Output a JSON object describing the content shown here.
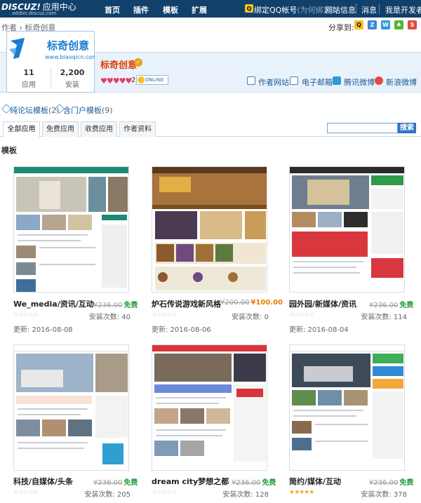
{
  "topbar": {
    "logo_main": "DISCUZ!",
    "logo_suffix": "应用中心",
    "logo_sub": "addon.discuz.com",
    "nav": [
      "首页",
      "插件",
      "模板",
      "扩展"
    ],
    "qq_bind": "绑定QQ帐号",
    "qq_bind_note": "(为何绑定?)",
    "site_info": "网站信息",
    "messages": "消息",
    "dev": "我是开发者",
    "bg_color": "#11406b"
  },
  "breadcrumb": {
    "root": "作者",
    "sep": "›",
    "current": "标奇创意"
  },
  "share": {
    "label": "分享到:",
    "icons": [
      "qq-icon",
      "qzone-icon",
      "tencent-weibo-icon",
      "pengyou-icon",
      "sina-weibo-icon"
    ]
  },
  "developer": {
    "logo_text": "标奇创意",
    "logo_url": "www.biaoqicn.com",
    "name": "标奇创意",
    "apps_count": "11",
    "apps_label": "应用",
    "installs_count": "2,200",
    "installs_label": "安装",
    "hearts": "♥♥♥♥♥",
    "hearts_count": "2",
    "qq_status": "ONLINE",
    "contacts": [
      "作者网站",
      "电子邮箱",
      "腾讯微博",
      "新浪微博"
    ]
  },
  "template_links": [
    {
      "label": "纯论坛模板",
      "count": "(2)"
    },
    {
      "label": "含门户模板",
      "count": "(9)"
    }
  ],
  "tabs": [
    "全部应用",
    "免费应用",
    "收费应用",
    "作者资料"
  ],
  "search": {
    "value": "",
    "button": "搜索"
  },
  "section_title": "模板",
  "items": [
    {
      "name": "We_media/资讯/互动",
      "old_price": "¥236.00",
      "price": "免费",
      "price_type": "free",
      "install_label": "安装次数:",
      "installs": "40",
      "updated": "更新: 2016-08-08",
      "stars": "☆☆☆☆☆"
    },
    {
      "name": "炉石传说游戏新风格",
      "old_price": "¥200.00",
      "price": "¥100.00",
      "price_type": "sale",
      "install_label": "安装次数:",
      "installs": "0",
      "updated": "更新: 2016-08-06",
      "stars": "☆☆☆☆☆"
    },
    {
      "name": "园外园/新媒体/资讯",
      "old_price": "¥236.00",
      "price": "免费",
      "price_type": "free",
      "install_label": "安装次数:",
      "installs": "114",
      "updated": "更新: 2016-08-04",
      "stars": "☆☆☆☆☆"
    },
    {
      "name": "科技/自媒体/头条",
      "old_price": "¥236.00",
      "price": "免费",
      "price_type": "free",
      "install_label": "安装次数:",
      "installs": "205",
      "updated": "",
      "stars": "☆☆☆☆☆"
    },
    {
      "name": "dream city梦想之都",
      "old_price": "¥236.00",
      "price": "免费",
      "price_type": "free",
      "install_label": "安装次数:",
      "installs": "128",
      "updated": "",
      "stars": "☆☆☆☆☆"
    },
    {
      "name": "简约/媒体/互动",
      "old_price": "¥236.00",
      "price": "免费",
      "price_type": "free",
      "install_label": "安装次数:",
      "installs": "378",
      "updated": "",
      "stars": "★★★★★"
    }
  ],
  "colors": {
    "link": "#1a5a98",
    "price_free": "#2b9d3e",
    "price_sale": "#f07a00",
    "dev_name": "#e03a00"
  }
}
